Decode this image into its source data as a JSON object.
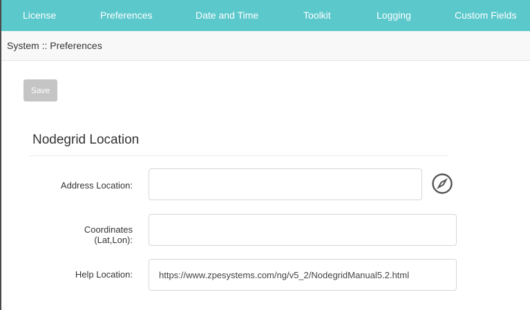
{
  "nav": {
    "tabs": [
      {
        "label": "License"
      },
      {
        "label": "Preferences"
      },
      {
        "label": "Date and Time"
      },
      {
        "label": "Toolkit"
      },
      {
        "label": "Logging"
      },
      {
        "label": "Custom Fields"
      }
    ],
    "active_tab": "Preferences",
    "bar_color": "#5bc8cc"
  },
  "breadcrumb": "System :: Preferences",
  "toolbar": {
    "save_label": "Save"
  },
  "section": {
    "title": "Nodegrid Location"
  },
  "fields": {
    "address": {
      "label": "Address Location:",
      "value": ""
    },
    "coordinates": {
      "label_line1": "Coordinates",
      "label_line2": "(Lat,Lon):",
      "value": ""
    },
    "help": {
      "label": "Help Location:",
      "value": "https://www.zpesystems.com/ng/v5_2/NodegridManual5.2.html"
    }
  },
  "icons": {
    "locate": "compass-icon"
  }
}
